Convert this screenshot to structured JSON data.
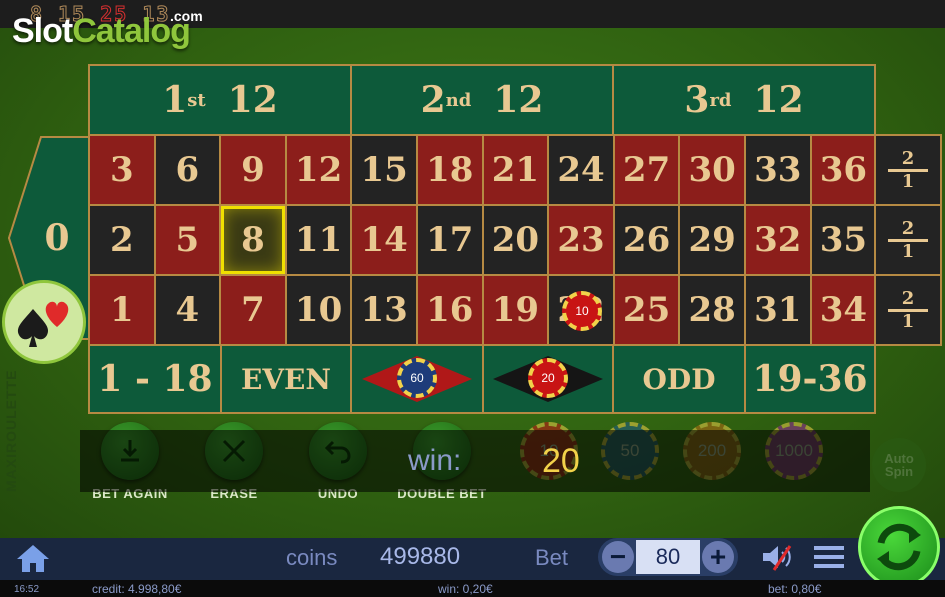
{
  "history": {
    "numbers": [
      "8",
      "15",
      "25",
      "13"
    ],
    "red": [
      false,
      false,
      true,
      false
    ]
  },
  "branding": {
    "logo_slot": "Slot",
    "logo_catalog": "Catalog",
    "logo_com": ".com",
    "vertical_brand": "MAXIROULETTE"
  },
  "table": {
    "zero": "0",
    "dozens": [
      {
        "ord": "1",
        "sup": "st",
        "num": "12"
      },
      {
        "ord": "2",
        "sup": "nd",
        "num": "12"
      },
      {
        "ord": "3",
        "sup": "rd",
        "num": "12"
      }
    ],
    "rows": [
      [
        {
          "n": "3",
          "c": "red"
        },
        {
          "n": "6",
          "c": "black"
        },
        {
          "n": "9",
          "c": "red"
        },
        {
          "n": "12",
          "c": "red"
        },
        {
          "n": "15",
          "c": "black"
        },
        {
          "n": "18",
          "c": "red"
        },
        {
          "n": "21",
          "c": "red"
        },
        {
          "n": "24",
          "c": "black"
        },
        {
          "n": "27",
          "c": "red"
        },
        {
          "n": "30",
          "c": "red"
        },
        {
          "n": "33",
          "c": "black"
        },
        {
          "n": "36",
          "c": "red"
        }
      ],
      [
        {
          "n": "2",
          "c": "black"
        },
        {
          "n": "5",
          "c": "red"
        },
        {
          "n": "8",
          "c": "black"
        },
        {
          "n": "11",
          "c": "black"
        },
        {
          "n": "14",
          "c": "red"
        },
        {
          "n": "17",
          "c": "black"
        },
        {
          "n": "20",
          "c": "black"
        },
        {
          "n": "23",
          "c": "red"
        },
        {
          "n": "26",
          "c": "black"
        },
        {
          "n": "29",
          "c": "black"
        },
        {
          "n": "32",
          "c": "red"
        },
        {
          "n": "35",
          "c": "black"
        }
      ],
      [
        {
          "n": "1",
          "c": "red"
        },
        {
          "n": "4",
          "c": "black"
        },
        {
          "n": "7",
          "c": "red"
        },
        {
          "n": "10",
          "c": "black"
        },
        {
          "n": "13",
          "c": "black"
        },
        {
          "n": "16",
          "c": "red"
        },
        {
          "n": "19",
          "c": "red"
        },
        {
          "n": "22",
          "c": "black"
        },
        {
          "n": "25",
          "c": "red"
        },
        {
          "n": "28",
          "c": "black"
        },
        {
          "n": "31",
          "c": "black"
        },
        {
          "n": "34",
          "c": "red"
        }
      ]
    ],
    "selected_number": "8",
    "column_payout": {
      "top": "2",
      "bottom": "1"
    },
    "outside": {
      "low": "1 - 18",
      "even": "EVEN",
      "odd": "ODD",
      "high": "19-36"
    },
    "chips_on_table": {
      "red_diamond": "60",
      "black_diamond": "20",
      "number_22": "10"
    }
  },
  "controls": {
    "bet_again": "BET AGAIN",
    "erase": "ERASE",
    "undo": "UNDO",
    "double_bet": "DOUBLE BET",
    "auto_spin": "Auto Spin"
  },
  "win": {
    "label": "win:",
    "value": "20"
  },
  "chip_values": [
    "10",
    "50",
    "200",
    "1000"
  ],
  "bottom": {
    "coins_label": "coins",
    "coins_value": "499880",
    "bet_label": "Bet",
    "bet_value": "80",
    "minus": "−",
    "plus": "+"
  },
  "status": {
    "time": "16:52",
    "credit": "credit: 4.998,80€",
    "win": "win: 0,20€",
    "bet": "bet: 0,80€"
  },
  "colors": {
    "red_cell": "#8c1e1b",
    "black_cell": "#232323",
    "green_cell": "#0d5a3a",
    "gold": "#e8c891",
    "highlight": "#f0e000"
  }
}
